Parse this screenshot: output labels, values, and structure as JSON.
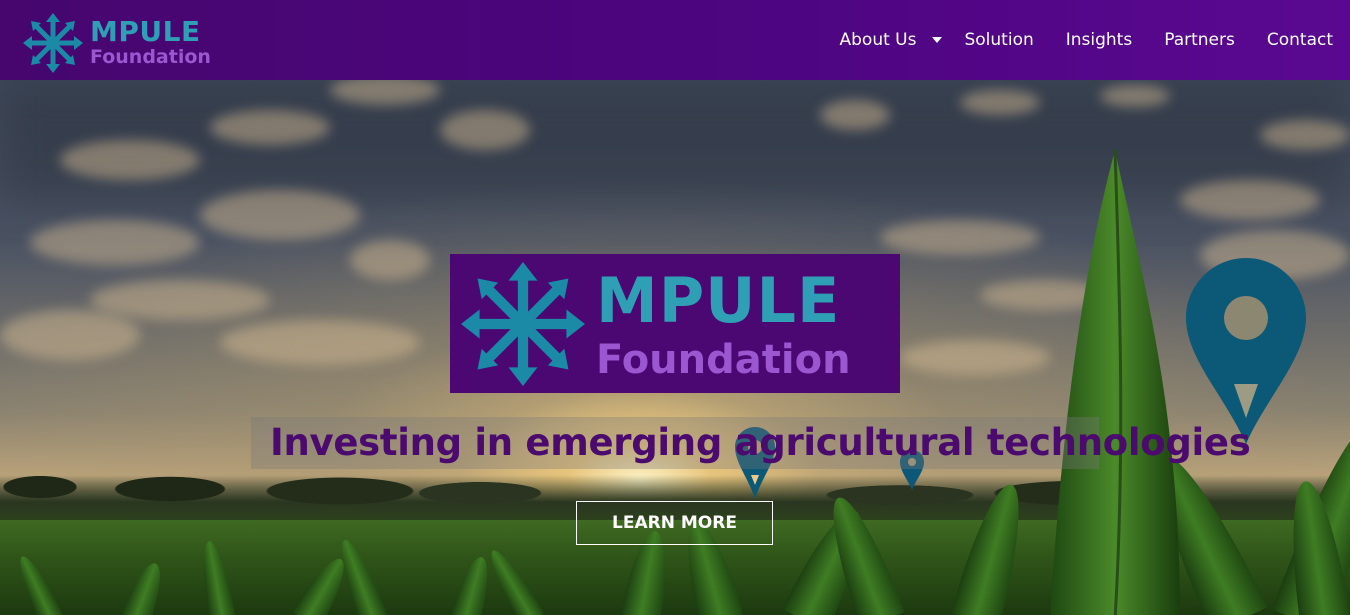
{
  "header": {
    "logo": {
      "name": "MPULE",
      "sub": "Foundation",
      "icon": "snowflake-arrows-icon"
    },
    "nav": [
      {
        "label": "About Us",
        "has_dropdown": true
      },
      {
        "label": "Solution"
      },
      {
        "label": "Insights"
      },
      {
        "label": "Partners"
      },
      {
        "label": "Contact"
      }
    ]
  },
  "hero": {
    "logo": {
      "name": "MPULE",
      "sub": "Foundation",
      "icon": "snowflake-arrows-icon"
    },
    "tagline": "Investing in emerging agricultural technologies",
    "cta_label": "LEARN MORE",
    "background": "cornfield-sunset-photo",
    "pin_icon": "map-pin-icon"
  },
  "colors": {
    "header_bg": "#4d0580",
    "brand_teal": "#2f9fb5",
    "brand_purple": "#9a57d0",
    "logo_box_bg": "#4b0772",
    "tagline_color": "#4a0a6e",
    "pin_color": "#0b5877"
  }
}
